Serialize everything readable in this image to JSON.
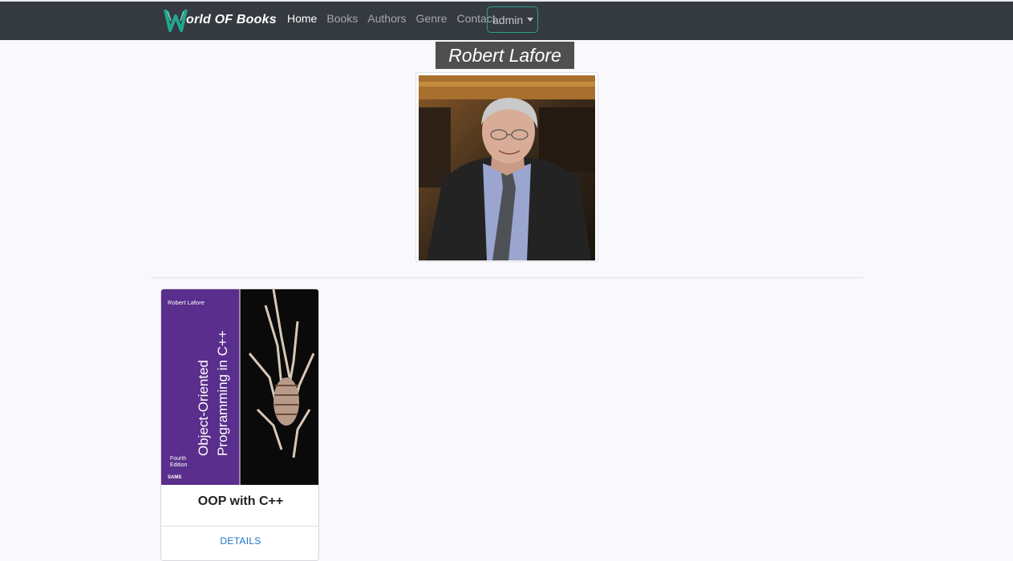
{
  "navbar": {
    "brand_initial": "W",
    "brand_text": "orld OF Books",
    "links": [
      "Home",
      "Books",
      "Authors",
      "Genre",
      "Contact"
    ],
    "user_menu": "admin"
  },
  "author": {
    "name": "Robert Lafore"
  },
  "book": {
    "cover": {
      "author": "Robert Lafore",
      "title_line1": "Object-Oriented",
      "title_line2": "Programming in C++",
      "edition_line1": "Fourth",
      "edition_line2": "Edition",
      "publisher": "SAMS"
    },
    "title": "OOP with C++",
    "details_label": "DETAILS"
  },
  "colors": {
    "navbar_bg": "#343a40",
    "accent_teal": "#28a08a",
    "cover_purple": "#5a2e8c",
    "link_blue": "#1a73c8"
  }
}
